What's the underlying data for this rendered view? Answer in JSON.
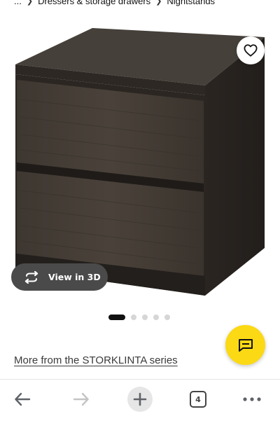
{
  "breadcrumb": {
    "ellipsis": "...",
    "items": [
      "Dressers & storage drawers",
      "Nightstands"
    ]
  },
  "product": {
    "view_3d_label": "View in 3D",
    "carousel": {
      "total_images": 5,
      "active_index": 0
    },
    "series_link": "More from the STORKLINTA series"
  },
  "bottom_bar": {
    "tab_count": "4"
  },
  "colors": {
    "accent_yellow": "#fbd914",
    "view3d_bg": "#4a4a4a",
    "wood_dark": "#3b3530"
  },
  "icons": {
    "favorite": "heart-icon",
    "view_3d": "rotate-3d-icon",
    "chat": "chat-icon",
    "back": "arrow-left-icon",
    "forward": "arrow-right-icon",
    "new_tab": "plus-icon",
    "tabs": "tabs-count-icon",
    "menu": "more-horizontal-icon"
  }
}
